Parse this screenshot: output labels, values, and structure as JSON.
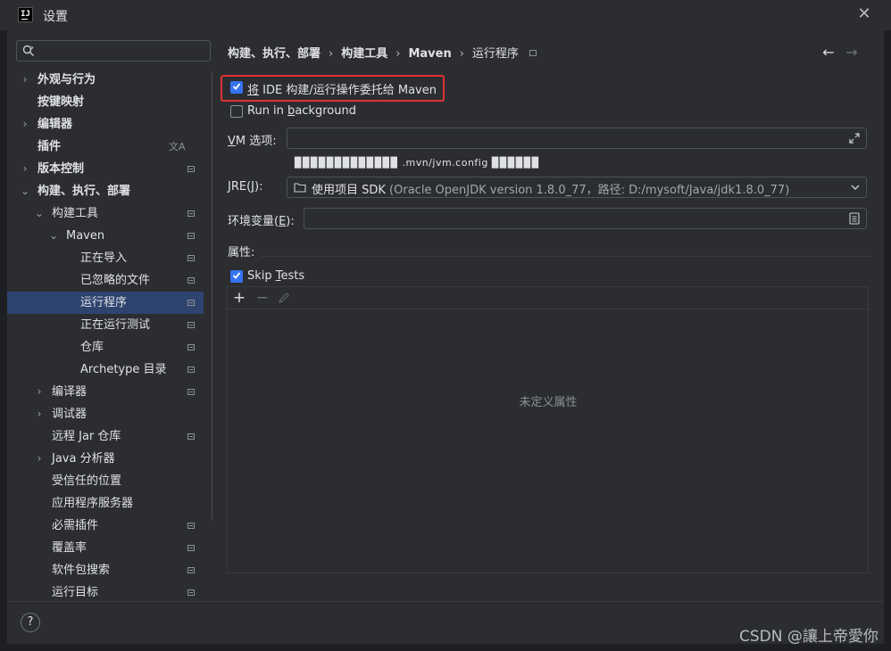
{
  "window": {
    "title": "设置",
    "logo_text": "IJ"
  },
  "search": {
    "placeholder": "",
    "value": ""
  },
  "sidebar": {
    "items": [
      {
        "label": "外观与行为",
        "expandable": true,
        "expanded": false,
        "bold": true
      },
      {
        "label": "按键映射",
        "bold": true
      },
      {
        "label": "编辑器",
        "expandable": true,
        "expanded": false,
        "bold": true
      },
      {
        "label": "插件",
        "bold": true,
        "icon": "translate-icon"
      },
      {
        "label": "版本控制",
        "expandable": true,
        "expanded": false,
        "bold": true
      },
      {
        "label": "构建、执行、部署",
        "expandable": true,
        "expanded": true,
        "bold": true
      },
      {
        "label": "构建工具",
        "expandable": true,
        "expanded": true
      },
      {
        "label": "Maven",
        "expandable": true,
        "expanded": true
      },
      {
        "label": "正在导入"
      },
      {
        "label": "已忽略的文件"
      },
      {
        "label": "运行程序",
        "selected": true
      },
      {
        "label": "正在运行测试"
      },
      {
        "label": "仓库"
      },
      {
        "label": "Archetype 目录"
      },
      {
        "label": "编译器",
        "expandable": true,
        "expanded": false
      },
      {
        "label": "调试器",
        "expandable": true,
        "expanded": false
      },
      {
        "label": "远程 Jar 仓库"
      },
      {
        "label": "Java 分析器",
        "expandable": true,
        "expanded": false
      },
      {
        "label": "受信任的位置"
      },
      {
        "label": "应用程序服务器"
      },
      {
        "label": "必需插件"
      },
      {
        "label": "覆盖率"
      },
      {
        "label": "软件包搜索"
      },
      {
        "label": "运行目标"
      }
    ]
  },
  "breadcrumb": {
    "parts": [
      "构建、执行、部署",
      "构建工具",
      "Maven",
      "运行程序"
    ]
  },
  "nav": {
    "back": "←",
    "forward": "→"
  },
  "options": {
    "delegate": {
      "mnemonic": "将",
      "rest": " IDE 构建/运行操作委托给 Maven",
      "checked": true
    },
    "run_in_background": {
      "before": "Run in ",
      "mnemonic": "b",
      "after": "ackground",
      "checked": false
    }
  },
  "vm": {
    "label_mnemonic": "V",
    "label_rest": "M 选项:",
    "value": ""
  },
  "vm_hint": {
    "prefix": "▉▉▉▉▉▉▉▉▉▉▉▉▉",
    "file": ".mvn/jvm.config",
    "suffix": "▉▉▉▉▉▉"
  },
  "jre": {
    "label_before": "JRE(",
    "label_mnemonic": "J",
    "label_after": "):",
    "value_main": "使用项目 SDK",
    "value_detail": " (Oracle OpenJDK version 1.8.0_77，路径: D:/mysoft/Java/jdk1.8.0_77)"
  },
  "env": {
    "label_before": "环境变量(",
    "label_mnemonic": "E",
    "label_after": "):",
    "value": ""
  },
  "properties": {
    "section_label": "属性:",
    "skip_tests": {
      "before": "Skip ",
      "mnemonic": "T",
      "after": "ests",
      "checked": true
    },
    "toolbar": {
      "add": "+",
      "remove": "−"
    },
    "empty_text": "未定义属性"
  },
  "footer": {
    "help": "?"
  },
  "watermark": "CSDN @讓上帝愛你",
  "colors": {
    "accent": "#3574f0",
    "selection": "#2e436e",
    "highlight_border": "#e03232",
    "background": "#2b2d30"
  }
}
